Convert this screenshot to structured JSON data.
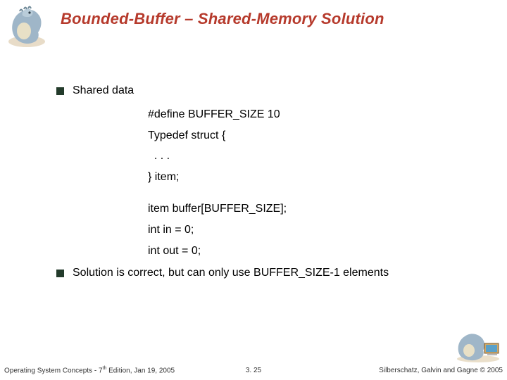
{
  "title": "Bounded-Buffer – Shared-Memory Solution",
  "bullets": {
    "b1": "Shared data",
    "b2": "Solution is correct, but can only use BUFFER_SIZE-1 elements"
  },
  "code": {
    "l1": "#define BUFFER_SIZE 10",
    "l2": "Typedef struct {",
    "l3": "  . . .",
    "l4": "} item;",
    "l5": "item buffer[BUFFER_SIZE];",
    "l6": "int in = 0;",
    "l7": "int out = 0;"
  },
  "footer": {
    "left_a": "Operating System Concepts - 7",
    "left_sup": "th",
    "left_b": " Edition, Jan 19, 2005",
    "center": "3. 25",
    "right_a": "Silberschatz, Galvin and Gagne ",
    "right_b": "© 2005"
  }
}
